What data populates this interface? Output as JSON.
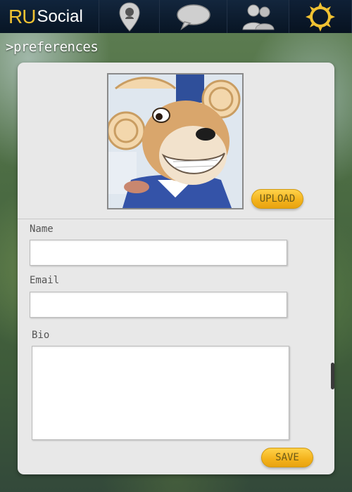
{
  "app": {
    "logo_ru": "RU",
    "logo_social": "Social"
  },
  "nav": {
    "tabs": [
      {
        "icon": "map-pin-icon",
        "active": false
      },
      {
        "icon": "chat-bubble-icon",
        "active": false
      },
      {
        "icon": "people-icon",
        "active": false
      },
      {
        "icon": "sun-settings-icon",
        "active": true
      }
    ],
    "accent": "#f1c232"
  },
  "breadcrumb": ">preferences",
  "profile": {
    "upload_label": "UPLOAD",
    "name_label": "Name",
    "name_value": "",
    "email_label": "Email",
    "email_value": "",
    "bio_label": "Bio",
    "bio_value": "",
    "save_label": "SAVE"
  },
  "colors": {
    "navbar": "#0b1a2c",
    "panel": "#e8e8e8",
    "button": "#f3b21b"
  }
}
